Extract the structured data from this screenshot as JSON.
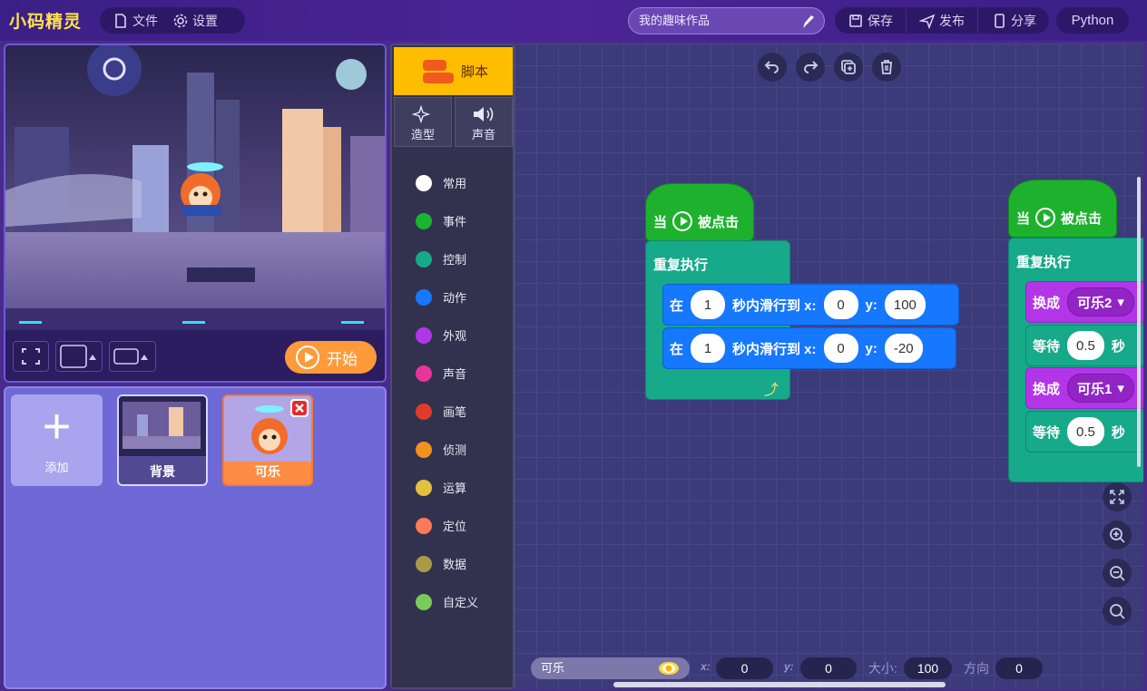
{
  "app": {
    "logo": "小码精灵",
    "menu": {
      "file": "文件",
      "settings": "设置"
    },
    "project_title_placeholder": "我的趣味作品",
    "actions": {
      "save": "保存",
      "publish": "发布",
      "share": "分享"
    },
    "python": "Python"
  },
  "stage": {
    "start_label": "开始"
  },
  "sprites": {
    "add_label": "添加",
    "items": [
      {
        "name": "背景"
      },
      {
        "name": "可乐"
      }
    ]
  },
  "palette": {
    "tabs": {
      "script": "脚本",
      "costume": "造型",
      "sound": "声音"
    },
    "categories": [
      {
        "label": "常用",
        "color": "#ffffff"
      },
      {
        "label": "事件",
        "color": "#18b52e"
      },
      {
        "label": "控制",
        "color": "#16a98a"
      },
      {
        "label": "动作",
        "color": "#1677ff"
      },
      {
        "label": "外观",
        "color": "#b236e8"
      },
      {
        "label": "声音",
        "color": "#e8359a"
      },
      {
        "label": "画笔",
        "color": "#e03a2a"
      },
      {
        "label": "侦测",
        "color": "#f2911f"
      },
      {
        "label": "运算",
        "color": "#e2c23d"
      },
      {
        "label": "定位",
        "color": "#ff7a5a"
      },
      {
        "label": "数据",
        "color": "#a99b4a"
      },
      {
        "label": "自定义",
        "color": "#78cc5a"
      }
    ]
  },
  "scripts": {
    "script1": {
      "hat": {
        "when": "当",
        "clicked": "被点击"
      },
      "repeat": "重复执行",
      "glide1": {
        "in": "在",
        "secs": "1",
        "text": "秒内滑行到 x:",
        "x": "0",
        "ylabel": "y:",
        "y": "100"
      },
      "glide2": {
        "in": "在",
        "secs": "1",
        "text": "秒内滑行到 x:",
        "x": "0",
        "ylabel": "y:",
        "y": "-20"
      }
    },
    "script2": {
      "hat": {
        "when": "当",
        "clicked": "被点击"
      },
      "repeat": "重复执行",
      "switch1": {
        "label": "换成",
        "value": "可乐2"
      },
      "wait1": {
        "label": "等待",
        "value": "0.5",
        "unit": "秒"
      },
      "switch2": {
        "label": "换成",
        "value": "可乐1"
      },
      "wait2": {
        "label": "等待",
        "value": "0.5",
        "unit": "秒"
      }
    }
  },
  "status": {
    "sprite_name": "可乐",
    "x_label": "x:",
    "x": "0",
    "y_label": "y:",
    "y": "0",
    "size_label": "大小:",
    "size": "100",
    "direction_label": "方向",
    "direction": "0"
  }
}
